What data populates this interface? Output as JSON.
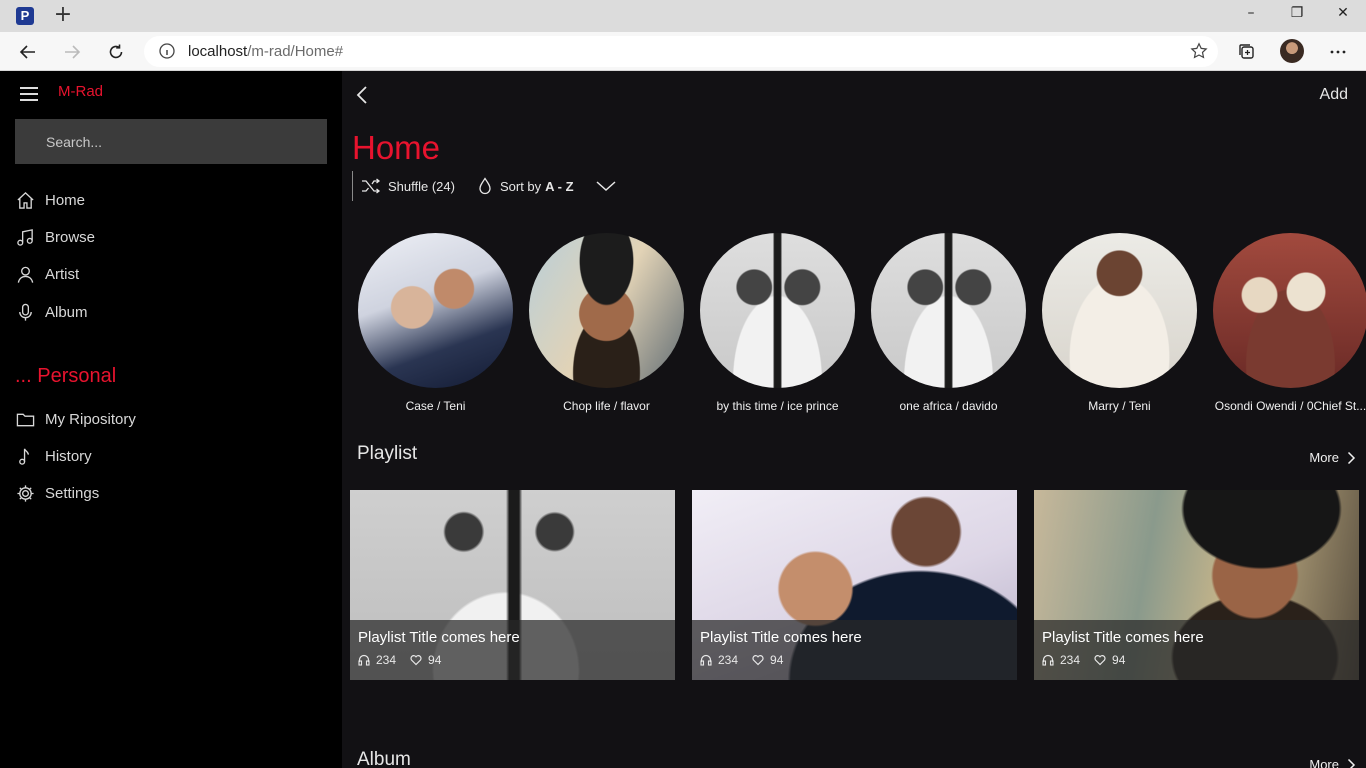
{
  "browser": {
    "favicon_letter": "P",
    "url_host": "localhost",
    "url_path": "/m-rad/Home#"
  },
  "app": {
    "brand": "M-Rad",
    "search_placeholder": "Search...",
    "nav": [
      {
        "label": "Home",
        "icon": "home-icon"
      },
      {
        "label": "Browse",
        "icon": "music-note-icon"
      },
      {
        "label": "Artist",
        "icon": "person-icon"
      },
      {
        "label": "Album",
        "icon": "microphone-icon"
      }
    ],
    "personal_title": "... Personal",
    "personal": [
      {
        "label": "My Ripository",
        "icon": "folder-icon"
      },
      {
        "label": "History",
        "icon": "note-icon"
      },
      {
        "label": "Settings",
        "icon": "gear-icon"
      }
    ]
  },
  "main": {
    "add_label": "Add",
    "title": "Home",
    "shuffle_label": "Shuffle (24)",
    "sort_prefix": "Sort by",
    "sort_value": "A - Z",
    "artists": [
      {
        "caption": "Case / Teni"
      },
      {
        "caption": "Chop life / flavor"
      },
      {
        "caption": "by this time / ice prince"
      },
      {
        "caption": "one africa / davido"
      },
      {
        "caption": "Marry / Teni"
      },
      {
        "caption": "Osondi Owendi / 0Chief St..."
      }
    ],
    "playlist_header": "Playlist",
    "more_label": "More",
    "playlists": [
      {
        "title": "Playlist Title comes here",
        "listens": "234",
        "likes": "94"
      },
      {
        "title": "Playlist Title comes here",
        "listens": "234",
        "likes": "94"
      },
      {
        "title": "Playlist Title comes here",
        "listens": "234",
        "likes": "94"
      }
    ],
    "album_header": "Album",
    "album_more_label": "More"
  },
  "colors": {
    "accent": "#e8132e",
    "sidebar_bg": "#000000",
    "main_bg": "#121114"
  }
}
